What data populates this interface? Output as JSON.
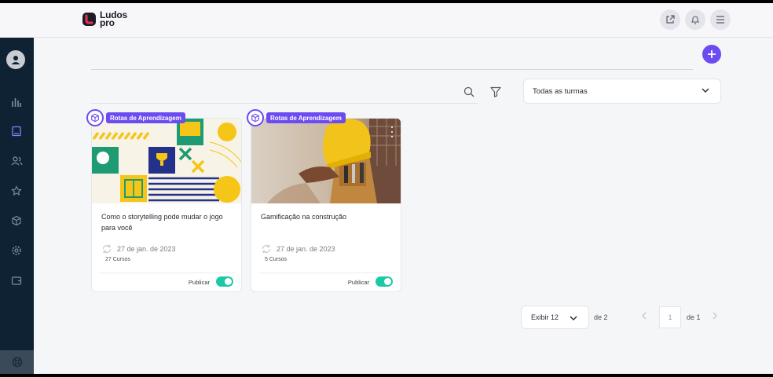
{
  "header": {
    "logo_line1": "Ludos",
    "logo_line2": "pro",
    "icons": [
      "external-link-icon",
      "bell-icon",
      "menu-icon"
    ]
  },
  "sidebar": {
    "items": [
      "profile-icon",
      "chart-icon",
      "book-icon",
      "users-icon",
      "star-icon",
      "box-icon",
      "gear-icon",
      "wallet-icon",
      "help-icon"
    ]
  },
  "filters": {
    "class_select": "Todas as turmas"
  },
  "cards": [
    {
      "badge": "Rotas de Aprendizagem",
      "title": "Como o storytelling pode mudar o jogo para você",
      "date": "27 de jan. de 2023",
      "count": "27 Cursos",
      "publish_label": "Publicar",
      "published": true
    },
    {
      "badge": "Rotas de Aprendizagem",
      "title": "Gamificação na construção",
      "date": "27 de jan. de 2023",
      "count": "5 Cursos",
      "publish_label": "Publicar",
      "published": true
    }
  ],
  "pagination": {
    "per_page": "Exibir 12",
    "of_pages": "de 2",
    "current_page": "1",
    "of_total": "de 1"
  },
  "colors": {
    "accent": "#6c4cf1",
    "sidebar": "#0f2233",
    "toggle_on": "#1bc9a7"
  }
}
